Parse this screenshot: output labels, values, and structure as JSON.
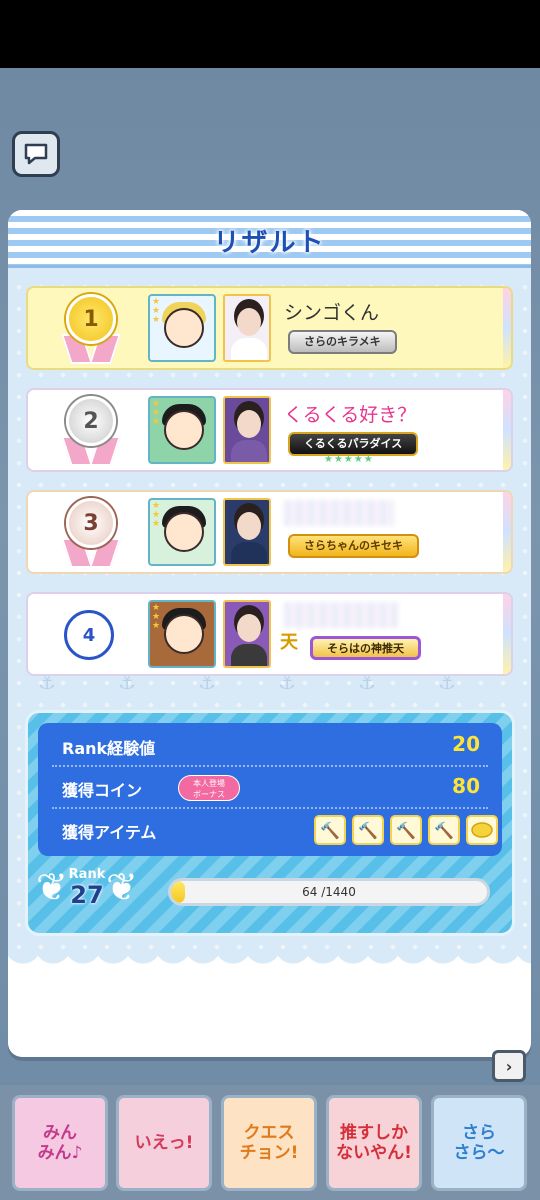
{
  "header": {
    "title": "リザルト"
  },
  "results": [
    {
      "rank": "1",
      "medal": "gold",
      "name": "シンゴくん",
      "name_color": "default",
      "title": "さらのキラメキ",
      "title_style": "silver",
      "hair_color": "#f0d35a",
      "body_color": "#ffffff"
    },
    {
      "rank": "2",
      "medal": "silver",
      "name": "くるくる好き？",
      "name_color": "pink",
      "title": "くるくるパラダイス",
      "title_style": "black",
      "hair_color": "#1c1c1c",
      "body_color": "#7a5ba8"
    },
    {
      "rank": "3",
      "medal": "bronze",
      "name": "",
      "name_color": "blurred",
      "title": "さらちゃんのキセキ",
      "title_style": "gold",
      "hair_color": "#1c1c1c",
      "body_color": "#20315a"
    },
    {
      "rank": "4",
      "medal": "none",
      "name": "",
      "name_color": "blurred",
      "title": "そらはの神推天",
      "title_style": "purple",
      "hair_color": "#1c1c1c",
      "body_color": "#3a3a3a"
    }
  ],
  "rewards": {
    "rank_exp_label": "Rank経験値",
    "rank_exp_value": "20",
    "coin_label": "獲得コイン",
    "coin_value": "80",
    "bonus_line1": "本人登場",
    "bonus_line2": "ボーナス",
    "items_label": "獲得アイテム",
    "items": [
      "hammer-icon",
      "hammer-icon",
      "hammer-icon",
      "hammer-icon",
      "coin-icon"
    ]
  },
  "rank": {
    "word": "Rank",
    "value": "27",
    "progress_text": "64 /1440",
    "progress_fraction": 0.044
  },
  "stamps": [
    {
      "text": "みん\nみん♪",
      "color": "#c23a8a",
      "bg": "#f6c9e2"
    },
    {
      "text": "いえっ!",
      "color": "#d43a5a",
      "bg": "#f5d0dc"
    },
    {
      "text": "クエス\nチョン!",
      "color": "#e07a1a",
      "bg": "#fde2c4"
    },
    {
      "text": "推すしか\nないやん!",
      "color": "#d42f3a",
      "bg": "#f7d2d6"
    },
    {
      "text": "さら\nさら〜",
      "color": "#2f7fd0",
      "bg": "#cfe5f7"
    }
  ],
  "icons": {
    "chat": "chat-bubble-icon",
    "scroll": "chevron-right-icon"
  }
}
